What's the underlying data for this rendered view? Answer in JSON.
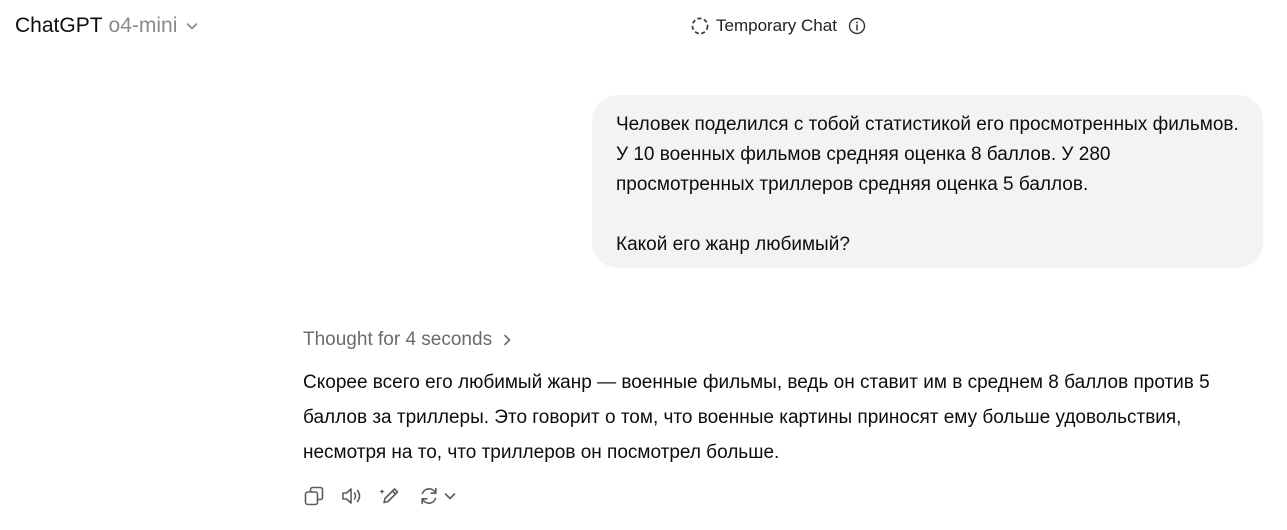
{
  "header": {
    "brand": "ChatGPT",
    "model": "o4-mini",
    "temporary_chat_label": "Temporary Chat"
  },
  "conversation": {
    "user_message": {
      "paragraph_1": "Человек поделился с тобой статистикой его просмотренных фильмов. У 10 военных фильмов средняя оценка 8 баллов. У 280 просмотренных триллеров средняя оценка 5 баллов.",
      "paragraph_2": "Какой его жанр любимый?"
    },
    "assistant_message": {
      "thought_label": "Thought for 4 seconds",
      "text": "Скорее всего его любимый жанр — военные фильмы, ведь он ставит им в среднем 8 баллов против 5 баллов за триллеры. Это говорит о том, что военные картины приносят ему больше удовольствия, несмотря на то, что триллеров он посмотрел больше."
    }
  },
  "icons": {
    "model_dropdown": "chevron-down-icon",
    "temporary_chat": "dashed-circle-icon",
    "info": "info-icon",
    "thought_expand": "chevron-right-icon",
    "copy": "copy-icon",
    "read_aloud": "speaker-icon",
    "edit_in_canvas": "pencil-sparkle-icon",
    "regenerate": "refresh-icon",
    "regenerate_menu": "chevron-down-icon"
  },
  "colors": {
    "user_bubble_bg": "#f3f3f3",
    "muted_text": "#8a8a8a",
    "thought_text": "#6b6b6b",
    "icon_gray": "#5d5d5d"
  }
}
